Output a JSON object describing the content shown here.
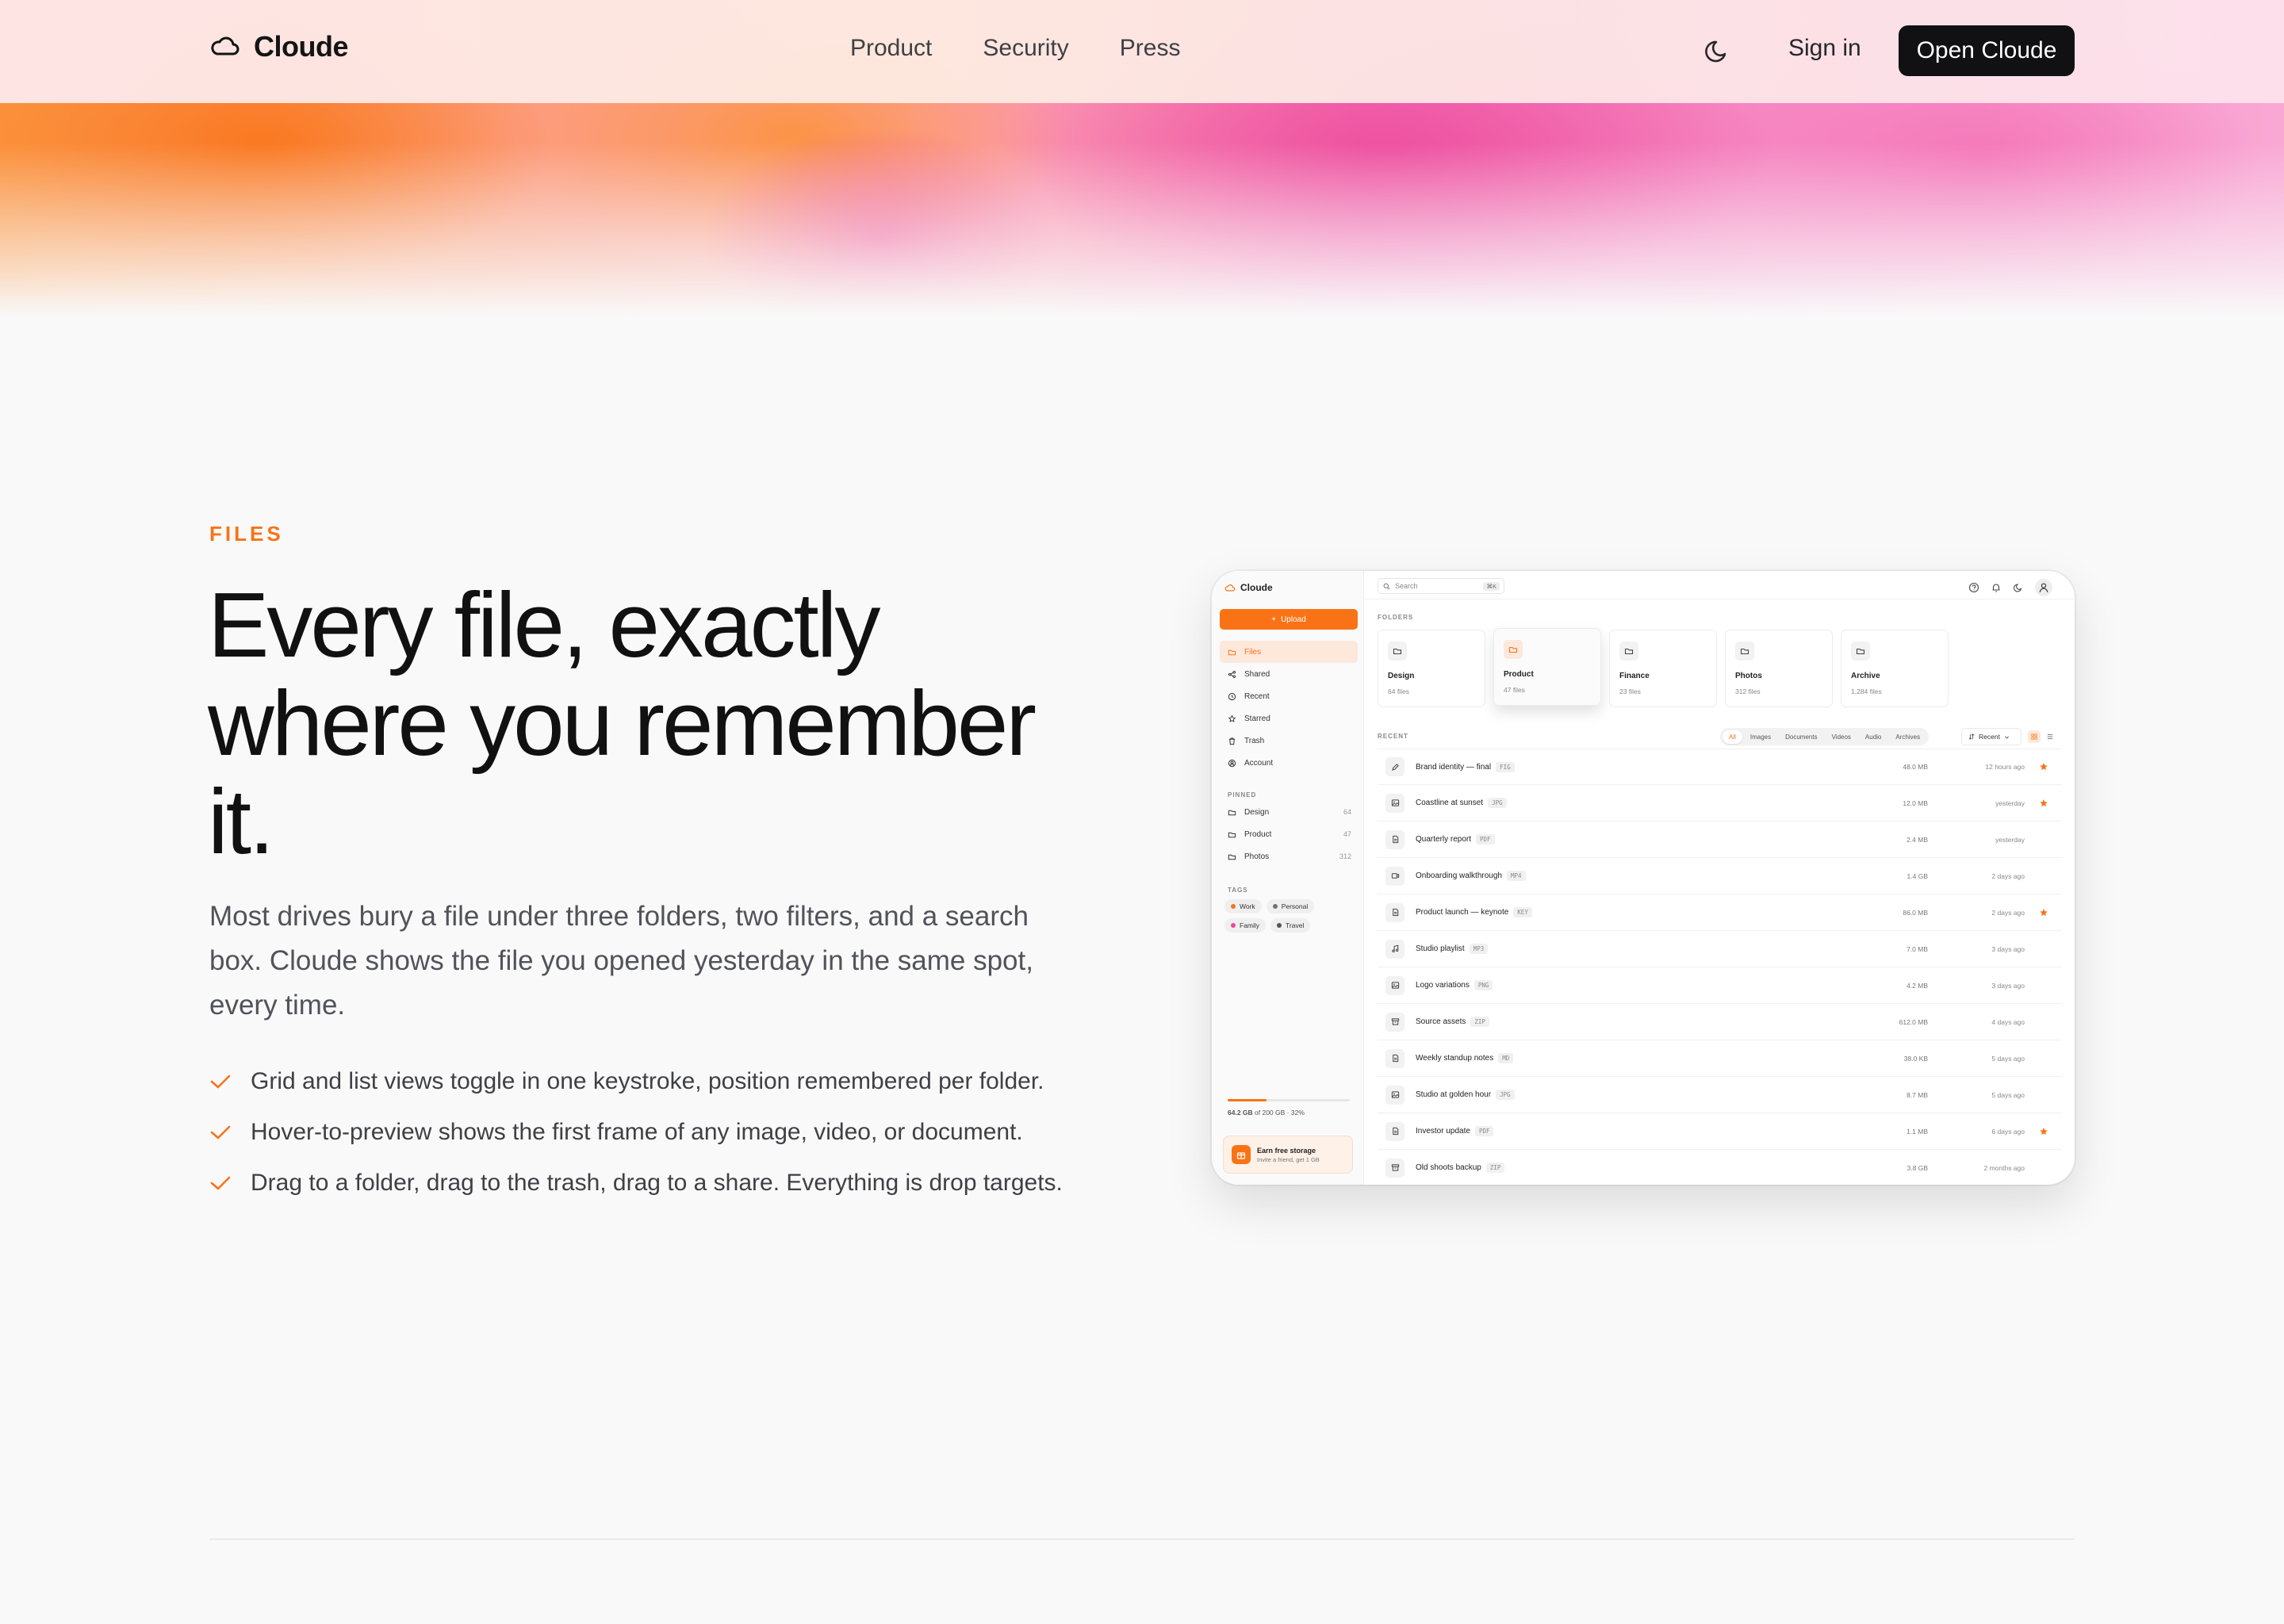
{
  "nav": {
    "brand": "Cloude",
    "links": [
      "Product",
      "Security",
      "Press"
    ],
    "signin": "Sign in",
    "cta": "Open Cloude"
  },
  "hero": {
    "eyebrow": "FILES",
    "headline": "Every file, exactly where you remember it.",
    "lede": "Most drives bury a file under three folders, two filters, and a search box. Cloude shows the file you opened yesterday in the same spot, every time.",
    "features": [
      "Grid and list views toggle in one keystroke, position remembered per folder.",
      "Hover-to-preview shows the first frame of any image, video, or document.",
      "Drag to a folder, drag to the trash, drag to a share. Everything is drop targets."
    ]
  },
  "colors": {
    "accent": "#f97316",
    "dark": "#111113"
  },
  "app": {
    "brand": "Cloude",
    "upload_label": "Upload",
    "nav": [
      {
        "label": "Files",
        "icon": "folder-icon",
        "active": true
      },
      {
        "label": "Shared",
        "icon": "share-icon"
      },
      {
        "label": "Recent",
        "icon": "clock-icon"
      },
      {
        "label": "Starred",
        "icon": "star-icon"
      },
      {
        "label": "Trash",
        "icon": "trash-icon"
      },
      {
        "label": "Account",
        "icon": "account-icon"
      }
    ],
    "pinned_heading": "PINNED",
    "pinned": [
      {
        "label": "Design",
        "count": "64"
      },
      {
        "label": "Product",
        "count": "47"
      },
      {
        "label": "Photos",
        "count": "312"
      }
    ],
    "tags_heading": "TAGS",
    "tags": [
      {
        "label": "Work",
        "color": "#f97316"
      },
      {
        "label": "Personal",
        "color": "#71717a"
      },
      {
        "label": "Family",
        "color": "#ec4899"
      },
      {
        "label": "Travel",
        "color": "#52525b"
      }
    ],
    "storage": {
      "used": "64.2 GB",
      "text": "of 200 GB · 32%",
      "fraction": 0.32
    },
    "earn": {
      "title": "Earn free storage",
      "sub": "Invite a friend, get 1 GB"
    },
    "search_placeholder": "Search",
    "search_kbd": "⌘K",
    "folders_heading": "FOLDERS",
    "folders": [
      {
        "name": "Design",
        "count": "64 files"
      },
      {
        "name": "Product",
        "count": "47 files",
        "hover": true
      },
      {
        "name": "Finance",
        "count": "23 files"
      },
      {
        "name": "Photos",
        "count": "312 files"
      },
      {
        "name": "Archive",
        "count": "1,284 files"
      }
    ],
    "recent_heading": "RECENT",
    "filters": [
      "All",
      "Images",
      "Documents",
      "Videos",
      "Audio",
      "Archives"
    ],
    "sort_label": "Recent",
    "files": [
      {
        "name": "Brand identity — final",
        "ext": "FIG",
        "size": "48.0 MB",
        "date": "12 hours ago",
        "starred": true,
        "icon": "pen-icon"
      },
      {
        "name": "Coastline at sunset",
        "ext": "JPG",
        "size": "12.0 MB",
        "date": "yesterday",
        "starred": true,
        "icon": "image-icon"
      },
      {
        "name": "Quarterly report",
        "ext": "PDF",
        "size": "2.4 MB",
        "date": "yesterday",
        "starred": false,
        "icon": "document-icon"
      },
      {
        "name": "Onboarding walkthrough",
        "ext": "MP4",
        "size": "1.4 GB",
        "date": "2 days ago",
        "starred": false,
        "icon": "video-icon"
      },
      {
        "name": "Product launch — keynote",
        "ext": "KEY",
        "size": "86.0 MB",
        "date": "2 days ago",
        "starred": true,
        "icon": "document-icon"
      },
      {
        "name": "Studio playlist",
        "ext": "MP3",
        "size": "7.0 MB",
        "date": "3 days ago",
        "starred": false,
        "icon": "music-icon"
      },
      {
        "name": "Logo variations",
        "ext": "PNG",
        "size": "4.2 MB",
        "date": "3 days ago",
        "starred": false,
        "icon": "image-icon"
      },
      {
        "name": "Source assets",
        "ext": "ZIP",
        "size": "612.0 MB",
        "date": "4 days ago",
        "starred": false,
        "icon": "archive-icon"
      },
      {
        "name": "Weekly standup notes",
        "ext": "MD",
        "size": "38.0 KB",
        "date": "5 days ago",
        "starred": false,
        "icon": "document-icon"
      },
      {
        "name": "Studio at golden hour",
        "ext": "JPG",
        "size": "8.7 MB",
        "date": "5 days ago",
        "starred": false,
        "icon": "image-icon"
      },
      {
        "name": "Investor update",
        "ext": "PDF",
        "size": "1.1 MB",
        "date": "6 days ago",
        "starred": true,
        "icon": "document-icon"
      },
      {
        "name": "Old shoots backup",
        "ext": "ZIP",
        "size": "3.8 GB",
        "date": "2 months ago",
        "starred": false,
        "icon": "archive-icon"
      }
    ]
  }
}
